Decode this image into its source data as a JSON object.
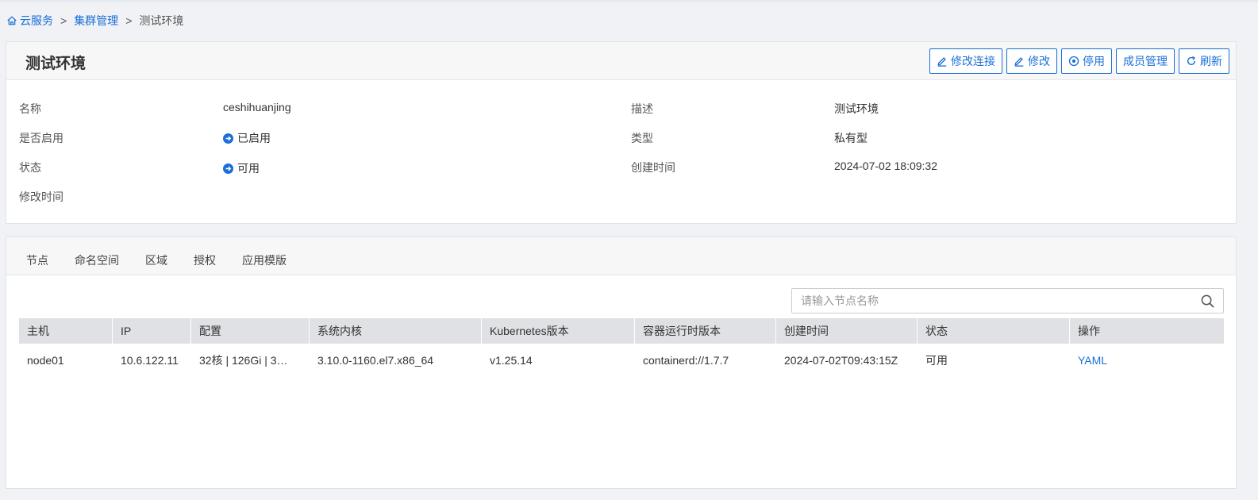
{
  "breadcrumb": {
    "home": "云服务",
    "cluster_mgmt": "集群管理",
    "current": "测试环境",
    "separator": ">"
  },
  "detail": {
    "title": "测试环境",
    "actions": {
      "edit_connection": "修改连接",
      "edit": "修改",
      "disable": "停用",
      "members": "成员管理",
      "refresh": "刷新"
    },
    "fields": {
      "name_label": "名称",
      "name_value": "ceshihuanjing",
      "enabled_label": "是否启用",
      "enabled_value": "已启用",
      "status_label": "状态",
      "status_value": "可用",
      "modified_label": "修改时间",
      "modified_value": "",
      "desc_label": "描述",
      "desc_value": "测试环境",
      "type_label": "类型",
      "type_value": "私有型",
      "created_label": "创建时间",
      "created_value": "2024-07-02 18:09:32"
    }
  },
  "tabs": {
    "nodes": "节点",
    "namespaces": "命名空间",
    "regions": "区域",
    "auth": "授权",
    "app_templates": "应用模版"
  },
  "search": {
    "placeholder": "请输入节点名称"
  },
  "table": {
    "columns": {
      "host": "主机",
      "ip": "IP",
      "config": "配置",
      "kernel": "系统内核",
      "k8s": "Kubernetes版本",
      "runtime": "容器运行时版本",
      "created": "创建时间",
      "status": "状态",
      "ops": "操作"
    },
    "rows": [
      {
        "host": "node01",
        "ip": "10.6.122.11",
        "config": "32核 | 126Gi | 3…",
        "kernel": "3.10.0-1160.el7.x86_64",
        "k8s": "v1.25.14",
        "runtime": "containerd://1.7.7",
        "created": "2024-07-02T09:43:15Z",
        "status": "可用",
        "op": "YAML"
      }
    ]
  },
  "colors": {
    "accent": "#1a6fd6",
    "header_bg": "#dfe1e4",
    "page_bg": "#f0f2f5"
  },
  "icons": {
    "home": "home-icon",
    "edit": "edit-icon",
    "disable": "stop-circle-icon",
    "refresh": "refresh-icon",
    "status": "arrow-circle-icon",
    "search": "search-icon"
  }
}
